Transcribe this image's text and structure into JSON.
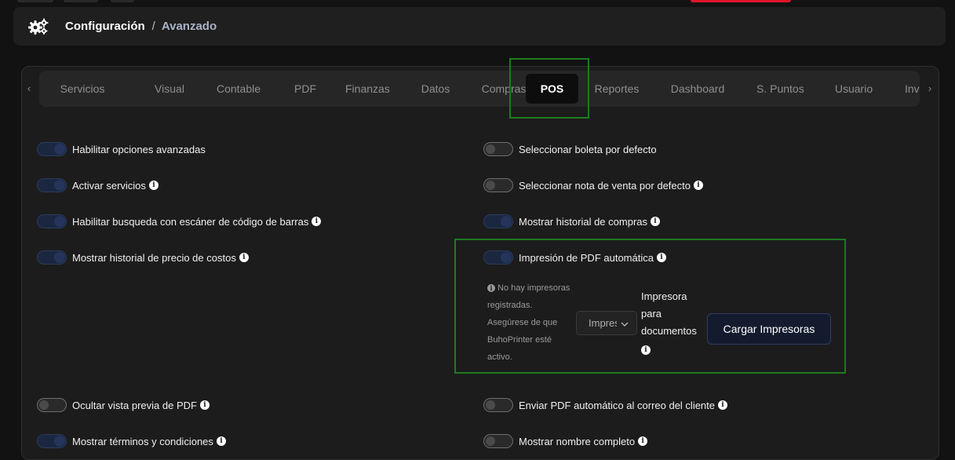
{
  "breadcrumb": {
    "root": "Configuración",
    "separator": "/",
    "current": "Avanzado"
  },
  "tabs": [
    {
      "label": "Servicios"
    },
    {
      "label": "Visual"
    },
    {
      "label": "Contable"
    },
    {
      "label": "PDF"
    },
    {
      "label": "Finanzas"
    },
    {
      "label": "Datos"
    },
    {
      "label": "Compras"
    },
    {
      "label": "POS"
    },
    {
      "label": "Reportes"
    },
    {
      "label": "Dashboard"
    },
    {
      "label": "S. Puntos"
    },
    {
      "label": "Usuario"
    },
    {
      "label": "Inv"
    }
  ],
  "active_tab": "POS",
  "options_left": [
    {
      "label": "Habilitar opciones avanzadas",
      "state": "on",
      "info": false
    },
    {
      "label": "Activar servicios",
      "state": "on",
      "info": true
    },
    {
      "label": "Habilitar busqueda con escáner de código de barras",
      "state": "on",
      "info": true
    },
    {
      "label": "Mostrar historial de precio de costos",
      "state": "on",
      "info": true
    },
    {
      "label": "Ocultar vista previa de PDF",
      "state": "off",
      "info": true
    },
    {
      "label": "Mostrar términos y condiciones",
      "state": "on",
      "info": true
    }
  ],
  "options_right": [
    {
      "label": "Seleccionar boleta por defecto",
      "state": "off",
      "info": false
    },
    {
      "label": "Seleccionar nota de venta por defecto",
      "state": "off",
      "info": true
    },
    {
      "label": "Mostrar historial de compras",
      "state": "on",
      "info": true
    },
    {
      "label": "Impresión de PDF automática",
      "state": "on",
      "info": true
    },
    {
      "label": "Enviar PDF automático al correo del cliente",
      "state": "off",
      "info": true
    },
    {
      "label": "Mostrar nombre completo",
      "state": "off",
      "info": true
    }
  ],
  "printer": {
    "warning": "No hay impresoras registradas. Asegúrese de que BuhoPrinter esté activo.",
    "select_value": "Impresora",
    "label": "Impresora para documentos",
    "load_button": "Cargar Impresoras"
  },
  "colors": {
    "highlight": "#1e7a1e",
    "toggle_on": "#1b2740",
    "button_bg": "#141b2e"
  },
  "icons": {
    "header": "gears-icon",
    "info": "info-circle-icon",
    "select": "chevron-down-icon"
  }
}
